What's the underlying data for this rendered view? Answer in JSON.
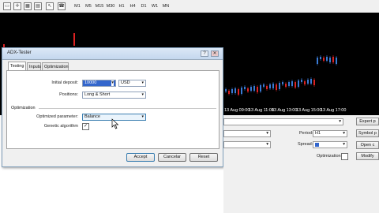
{
  "toolbar": {
    "timeframes": [
      "M1",
      "M5",
      "M15",
      "M30",
      "H1",
      "H4",
      "D1",
      "W1",
      "MN"
    ]
  },
  "chart": {
    "time_labels": [
      "13 Aug 09:00",
      "13 Aug 11:00",
      "13 Aug 13:00",
      "13 Aug 15:00",
      "13 Aug 17:00"
    ]
  },
  "dialog": {
    "title": "ADX-Tester",
    "help_glyph": "?",
    "close_glyph": "✕",
    "tabs": [
      "Testing",
      "Inputs",
      "Optimization"
    ],
    "initial_deposit_label": "Initial deposit:",
    "initial_deposit_value": "10000",
    "currency_value": "USD",
    "positions_label": "Positions:",
    "positions_value": "Long & Short",
    "optimization_section": "Optimization",
    "optimized_parameter_label": "Optimized parameter:",
    "optimized_parameter_value": "Balance",
    "genetic_label": "Genetic algorithm",
    "genetic_checked": "✓",
    "accept_label": "Accept",
    "cancel_label": "Cancelar",
    "reset_label": "Reset"
  },
  "tester": {
    "expert_btn": "Expert p",
    "symbol_btn": "Symbol p",
    "period_label": "Period:",
    "period_value": "H1",
    "spread_label": "Spread:",
    "spread_value": "",
    "open_chart_btn": "Open c",
    "optimization_label": "Optimization",
    "modify_btn": "Modify"
  }
}
